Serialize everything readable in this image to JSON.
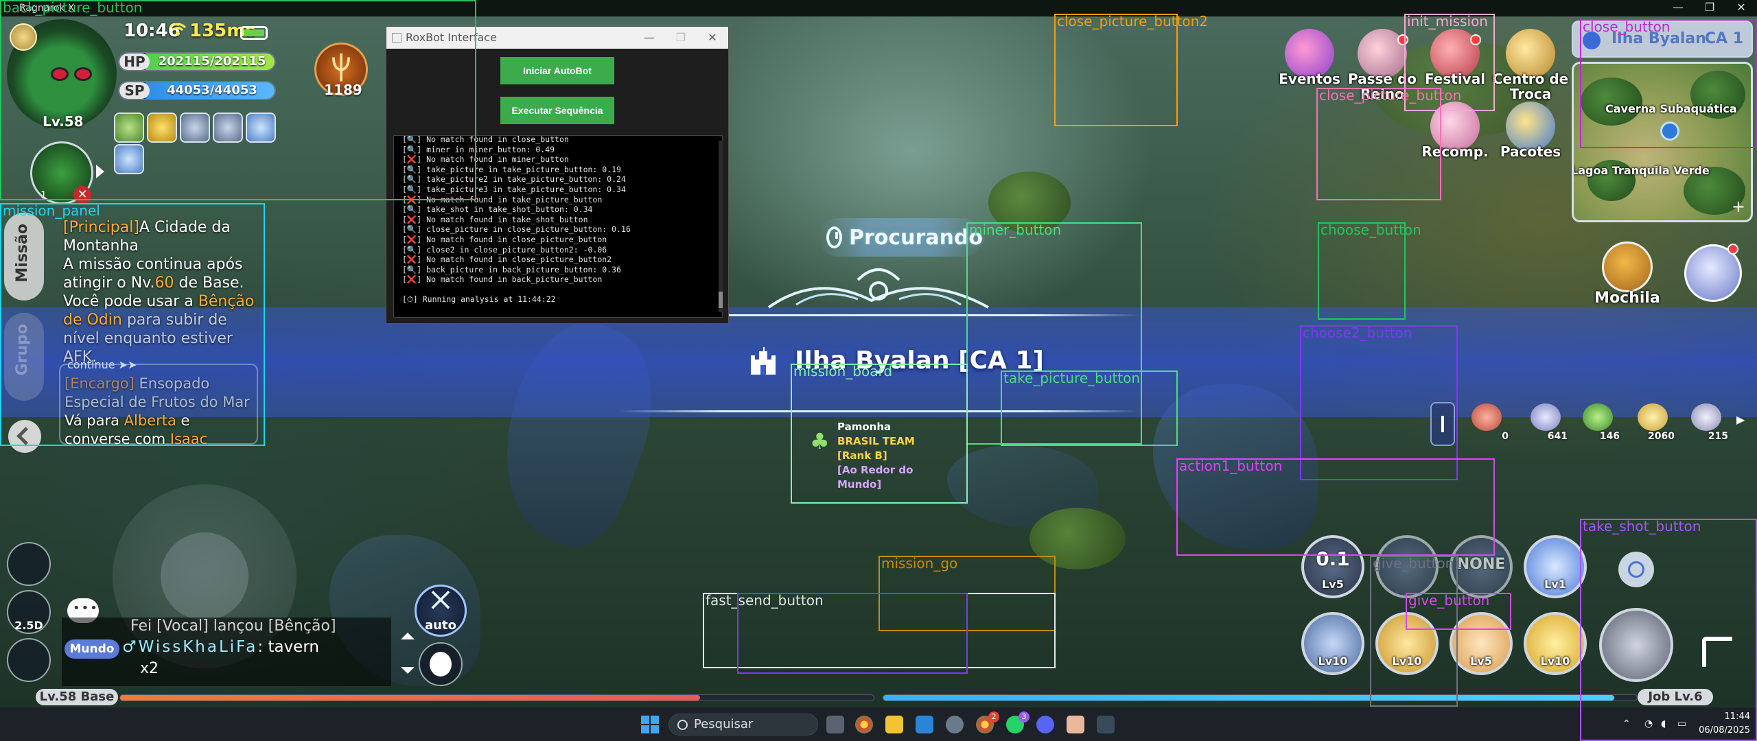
{
  "window": {
    "title": "Ragnarok X",
    "controls": [
      "—",
      "❐",
      "✕"
    ]
  },
  "player": {
    "level": "Lv.58",
    "time": "10:46",
    "ping": "135ms",
    "hp_label": "HP",
    "hp_value": "202115/202115",
    "sp_label": "SP",
    "sp_value": "44053/44053",
    "power": "1189",
    "pet_level": "1"
  },
  "mission": {
    "tab_main": "Missão",
    "tab_second": "Grupo",
    "title_tag": "[Principal]",
    "title": "A Cidade da Montanha",
    "body_1": "A missão continua após atingir o Nv.",
    "body_level": "60",
    "body_2": " de Base. Você pode usar a ",
    "body_blessing": "Bênção de Odin",
    "body_3": " para subir de nível enquanto estiver AFK.",
    "continue": "continue ➤➤",
    "task_tag": "[Encargo]",
    "task_title": " Ensopado Especial de Frutos do Mar",
    "task_body_1": "Vá para ",
    "task_place": "Alberta",
    "task_body_2": " e converse com ",
    "task_npc": "Isaac"
  },
  "roxbot": {
    "title": "RoxBot Interface",
    "btn_start": "Iniciar AutoBot",
    "btn_sequence": "Executar Sequência",
    "log": [
      "[🔍] No match found in close_button",
      "[🔍] miner in miner_button: 0.49",
      "[❌] No match found in miner_button",
      "[🔍] take_picture in take_picture_button: 0.19",
      "[🔍] take_picture2 in take_picture_button: 0.24",
      "[🔍] take_picture3 in take_picture_button: 0.34",
      "[❌] No match found in take_picture_button",
      "[🔍] take_shot in take_shot_button: 0.34",
      "[❌] No match found in take_shot_button",
      "[🔍] close_picture in close_picture_button: 0.16",
      "[❌] No match found in close_picture_button",
      "[🔍] close2 in close_picture_button2: -0.06",
      "[❌] No match found in close_picture_button2",
      "[🔍] back_picture in back_picture_button: 0.36",
      "[❌] No match found in back_picture_button"
    ],
    "running": "[⏱] Running analysis at 11:44:22"
  },
  "scene": {
    "searching": "Procurando",
    "location": "Ilha Byalan [CA 1]",
    "guild_player": "Pamonha",
    "guild_team": "BRASIL TEAM [Rank B]",
    "guild_motto": "[Ao Redor do Mundo]"
  },
  "menu": {
    "eventos": "Eventos",
    "passe": "Passe do Reino",
    "festival": "Festival",
    "centro": "Centro de Troca",
    "recomp": "Recomp.",
    "pacotes": "Pacotes",
    "mochila": "Mochila"
  },
  "map": {
    "name": "Ilha Byalan",
    "channel": "CA 1",
    "area_1": "Caverna Subaquática",
    "area_2": "Lagoa Tranquila Verde",
    "plus": "+"
  },
  "items": [
    {
      "count": "0"
    },
    {
      "count": "641"
    },
    {
      "count": "146"
    },
    {
      "count": "2060"
    },
    {
      "count": "215"
    }
  ],
  "skills": {
    "s1_big": "0.1",
    "s1_lv": "Lv5",
    "s2_lv": "",
    "s3_big": "NONE",
    "s4_lv": "Lv1",
    "s5_lv": "Lv10",
    "s6_lv": "Lv10",
    "s7_lv": "Lv5",
    "s8_lv": "Lv10"
  },
  "left_controls": {
    "view": "2.5D",
    "auto": "auto"
  },
  "chat": {
    "line1": "Fei [Vocal] lançou [Bênção]",
    "channel": "Mundo",
    "sender": "♂WissKhaLiFa",
    "message": ": tavern",
    "repeat": "x2"
  },
  "exp": {
    "base_label": "Lv.58 Base",
    "base_progress": 0.77,
    "job_label": "Job Lv.6",
    "job_progress": 0.97
  },
  "taskbar": {
    "search": "Pesquisar",
    "whatsapp_badge": "3",
    "chrome_badge": "2",
    "time": "11:44",
    "date": "06/08/2025"
  },
  "detections": [
    {
      "label": "back_picture_button",
      "color": "#22c55e"
    },
    {
      "label": "mission_panel",
      "color": "#22d3ee"
    },
    {
      "label": "close_picture_button2",
      "color": "#f59e0b"
    },
    {
      "label": "init_mission",
      "color": "#f9a8d4"
    },
    {
      "label": "close_button",
      "color": "#c026d3"
    },
    {
      "label": "close_picture_button",
      "color": "#f472b6"
    },
    {
      "label": "miner_button",
      "color": "#4ade80"
    },
    {
      "label": "choose_button",
      "color": "#22c55e"
    },
    {
      "label": "choose2_button",
      "color": "#7c3aed"
    },
    {
      "label": "take_picture_button",
      "color": "#4ade80"
    },
    {
      "label": "mission_board",
      "color": "#86efac"
    },
    {
      "label": "action1_button",
      "color": "#d946ef"
    },
    {
      "label": "take_shot_button",
      "color": "#a855f7"
    },
    {
      "label": "mission_go",
      "color": "#ca8a04"
    },
    {
      "label": "fast_send_button",
      "color": "#e5e7eb"
    },
    {
      "label": "give_button1",
      "color": "#6b7280"
    },
    {
      "label": "give_button",
      "color": "#d946ef"
    },
    {
      "label": "",
      "color": "#7c3aed"
    }
  ]
}
